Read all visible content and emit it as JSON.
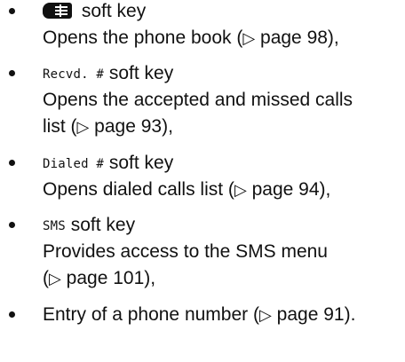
{
  "items": [
    {
      "lead": {
        "icon": "phone-book-icon",
        "rest": " soft key"
      },
      "line2": {
        "before": "Opens the phone book (",
        "arrow": "▷",
        "after": " page 98),"
      }
    },
    {
      "lead": {
        "key": "Recvd. #",
        "rest": " soft key"
      },
      "line2": "Opens the accepted and missed calls",
      "line3": {
        "before": "list (",
        "arrow": "▷",
        "after": " page 93),"
      }
    },
    {
      "lead": {
        "key": "Dialed #",
        "rest": " soft key"
      },
      "line2": {
        "before": "Opens dialed calls list (",
        "arrow": "▷",
        "after": " page 94),"
      }
    },
    {
      "lead": {
        "key": "SMS",
        "rest": " soft key"
      },
      "line2": "Provides access to the SMS menu",
      "line3": {
        "before": "(",
        "arrow": "▷",
        "after": " page 101),"
      }
    },
    {
      "lead": {
        "before": "Entry of a phone number (",
        "arrow": "▷",
        "after": " page 91)."
      }
    }
  ]
}
